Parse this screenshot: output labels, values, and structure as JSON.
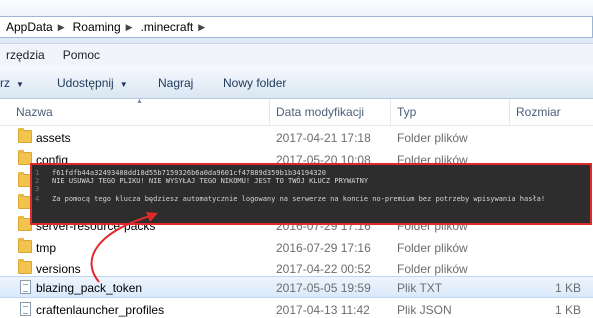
{
  "breadcrumb": [
    "AppData",
    "Roaming",
    ".minecraft"
  ],
  "menu": [
    "rzędzia",
    "Pomoc"
  ],
  "toolbar": {
    "organize": "rz",
    "share": "Udostępnij",
    "burn": "Nagraj",
    "new_folder": "Nowy folder"
  },
  "columns": {
    "name": "Nazwa",
    "modified": "Data modyfikacji",
    "type": "Typ",
    "size": "Rozmiar"
  },
  "files": [
    {
      "name": "assets",
      "date": "2017-04-21 17:18",
      "type": "Folder plików",
      "size": "",
      "kind": "folder",
      "selected": false
    },
    {
      "name": "config",
      "date": "2017-05-20 10:08",
      "type": "Folder plików",
      "size": "",
      "kind": "folder",
      "selected": false
    },
    {
      "name": "",
      "date": "",
      "type": "",
      "size": "",
      "kind": "folder",
      "selected": false
    },
    {
      "name": "",
      "date": "",
      "type": "",
      "size": "",
      "kind": "folder",
      "selected": false
    },
    {
      "name": "server-resource-packs",
      "date": "2016-07-29 17:16",
      "type": "Folder plików",
      "size": "",
      "kind": "folder",
      "selected": false
    },
    {
      "name": "tmp",
      "date": "2016-07-29 17:16",
      "type": "Folder plików",
      "size": "",
      "kind": "folder",
      "selected": false
    },
    {
      "name": "versions",
      "date": "2017-04-22 00:52",
      "type": "Folder plików",
      "size": "",
      "kind": "folder",
      "selected": false
    },
    {
      "name": "blazing_pack_token",
      "date": "2017-05-05 19:59",
      "type": "Plik TXT",
      "size": "1 KB",
      "kind": "doc",
      "selected": true
    },
    {
      "name": "craftenlauncher_profiles",
      "date": "2017-04-13 11:42",
      "type": "Plik JSON",
      "size": "1 KB",
      "kind": "doc",
      "selected": false
    }
  ],
  "overlay": {
    "lines": [
      {
        "num": "1",
        "text": "f61fdfb44a32493488dd18d55b7159326b6a0da9601cf47889d359b1b34194320"
      },
      {
        "num": "2",
        "text": "NIE USUWAJ TEGO PLIKU! NIE WYSYŁAJ TEGO NIKOMU! JEST TO TWÓJ KLUCZ PRYWATNY"
      },
      {
        "num": "3",
        "text": ""
      },
      {
        "num": "4",
        "text": "Za pomocą tego klucza będziesz automatycznie logowany na serwerze na koncie no-premium bez potrzeby wpisywania hasła!"
      }
    ],
    "border_color": "#e0292b"
  }
}
